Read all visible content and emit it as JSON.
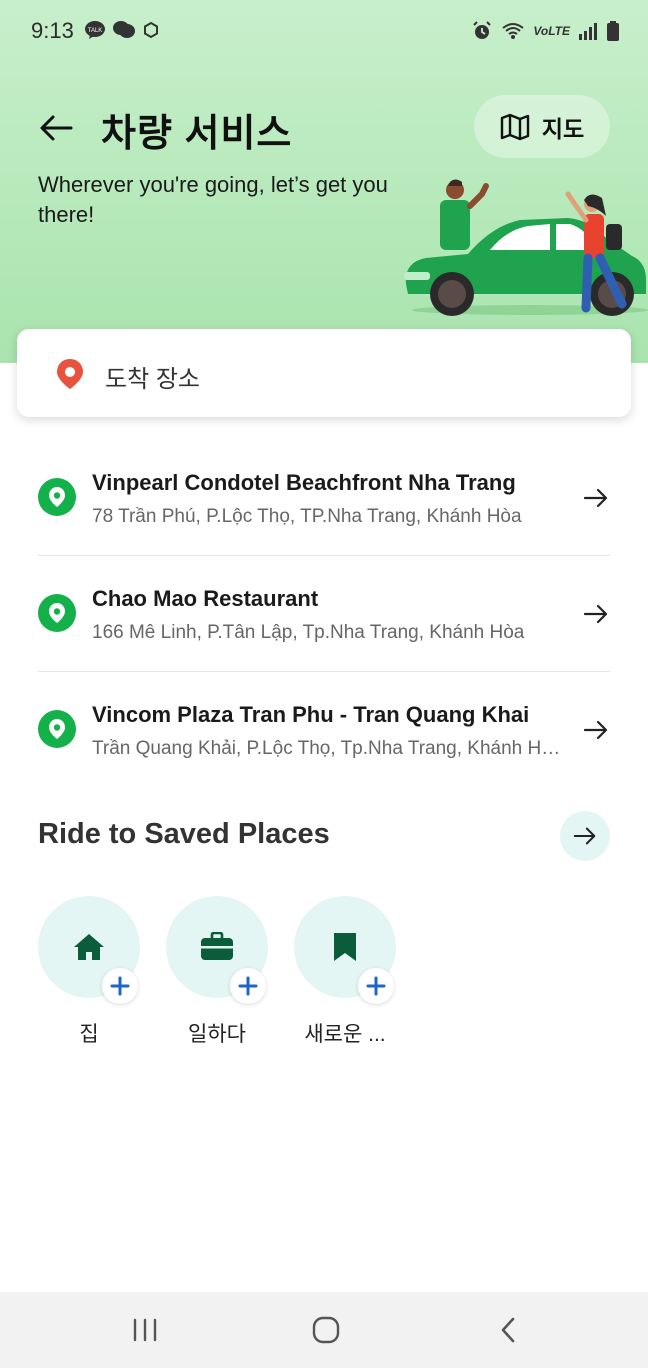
{
  "status_bar": {
    "time": "9:13",
    "left_icons": [
      "kakaotalk-icon",
      "chat-bubbles-icon",
      "hex-icon"
    ],
    "right_icons": [
      "alarm-icon",
      "wifi-icon",
      "volte-icon",
      "signal-icon",
      "battery-icon"
    ],
    "volte_label": "VoLTE"
  },
  "header": {
    "title": "차량 서비스",
    "map_button_label": "지도",
    "subtitle": "Wherever you're going, let’s get you there!"
  },
  "search": {
    "placeholder": "도착 장소"
  },
  "recent_places": [
    {
      "name": "Vinpearl Condotel Beachfront Nha Trang",
      "address": "78 Trần Phú, P.Lộc Thọ, TP.Nha Trang, Khánh Hòa"
    },
    {
      "name": "Chao Mao Restaurant",
      "address": "166 Mê Linh, P.Tân Lập, Tp.Nha Trang, Khánh Hòa"
    },
    {
      "name": "Vincom Plaza Tran Phu - Tran Quang Khai",
      "address": "Trần Quang Khải, P.Lộc Thọ, Tp.Nha Trang, Khánh Hòa"
    }
  ],
  "saved": {
    "title": "Ride to Saved Places",
    "places": [
      {
        "label": "집",
        "icon": "home-icon"
      },
      {
        "label": "일하다",
        "icon": "briefcase-icon"
      },
      {
        "label": "새로운 ...",
        "icon": "bookmark-icon"
      }
    ]
  },
  "colors": {
    "header_bg": "#b6e9bb",
    "accent_green": "#14b04a",
    "dark_green": "#0b5c3b",
    "plus_blue": "#1a66c9",
    "pin_red": "#e8533f"
  }
}
